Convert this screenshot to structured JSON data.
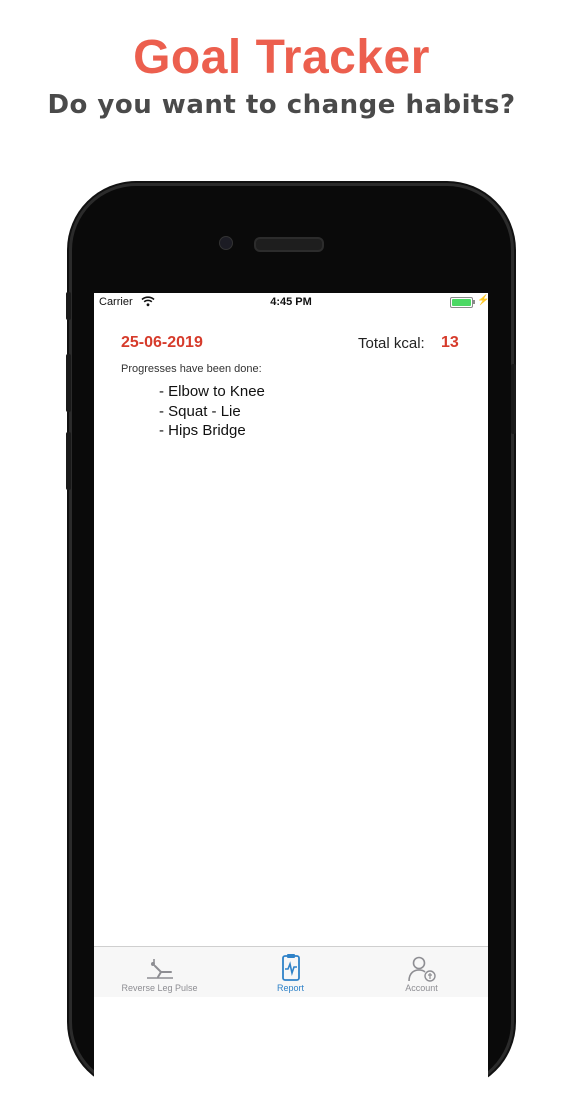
{
  "promo": {
    "title": "Goal Tracker",
    "subtitle": "Do you want to change habits?"
  },
  "status_bar": {
    "carrier": "Carrier",
    "time": "4:45 PM",
    "battery_level": 1.0,
    "charging": true
  },
  "report": {
    "date": "25-06-2019",
    "total_kcal_label": "Total kcal:",
    "total_kcal_value": "13",
    "progress_label": "Progresses have been done:",
    "exercises": [
      "- Elbow to Knee",
      "- Squat - Lie",
      "- Hips Bridge"
    ]
  },
  "tab_bar": {
    "tabs": [
      {
        "label": "Reverse Leg Pulse",
        "icon": "exercise-icon",
        "active": false
      },
      {
        "label": "Report",
        "icon": "report-icon",
        "active": true
      },
      {
        "label": "Account",
        "icon": "account-icon",
        "active": false
      }
    ]
  },
  "colors": {
    "title_accent": "#ec5f4e",
    "value_red": "#d63b2b",
    "tab_active": "#2f82c8",
    "tab_inactive": "#8e8e93",
    "battery_green": "#4cd964"
  }
}
